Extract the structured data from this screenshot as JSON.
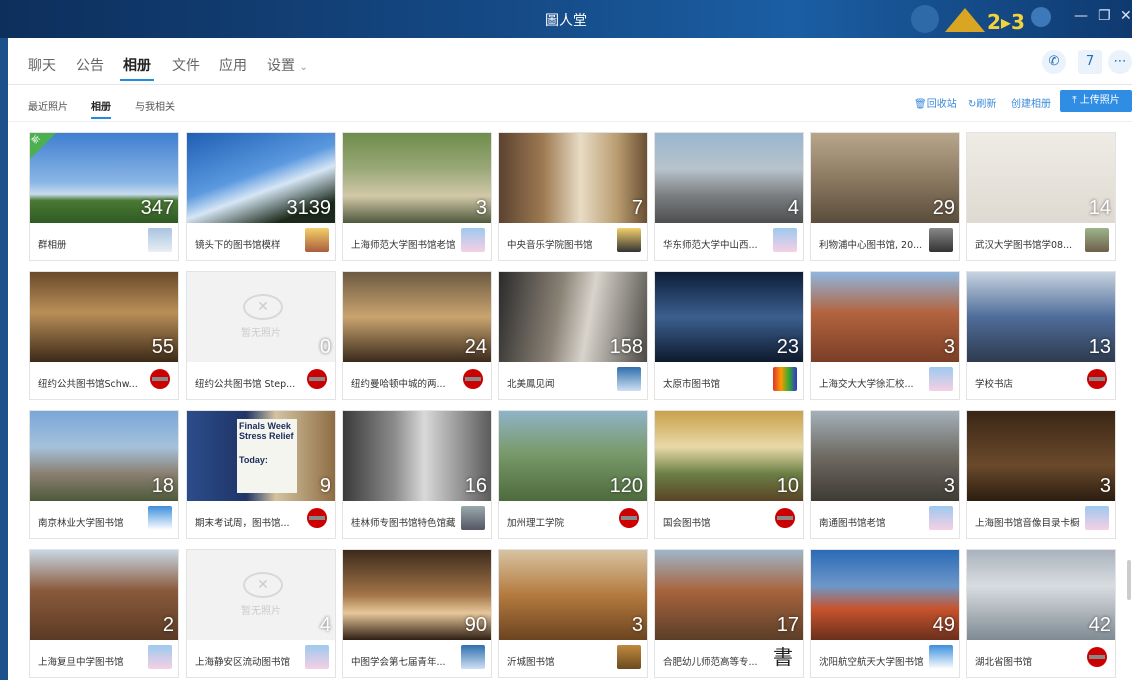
{
  "window": {
    "title": "圖人堂"
  },
  "tabs": [
    "聊天",
    "公告",
    "相册",
    "文件",
    "应用",
    "设置"
  ],
  "subtabs": [
    "最近照片",
    "相册",
    "与我相关"
  ],
  "actions": {
    "recycle": "回收站",
    "refresh": "刷新",
    "create": "创建相册",
    "upload": "上传照片"
  },
  "empty_label": "暂无照片",
  "new_tag": "新",
  "albums": [
    {
      "name": "群相册",
      "count": "347"
    },
    {
      "name": "镜头下的图书馆模样",
      "count": "3139"
    },
    {
      "name": "上海师范大学图书馆老馆",
      "count": "3"
    },
    {
      "name": "中央音乐学院图书馆",
      "count": "7"
    },
    {
      "name": "华东师范大学中山西...",
      "count": "4"
    },
    {
      "name": "利物浦中心图书馆, 20...",
      "count": "29"
    },
    {
      "name": "武汉大学图书馆学08...",
      "count": "14"
    },
    {
      "name": "纽约公共图书馆Schw...",
      "count": "55"
    },
    {
      "name": "纽约公共图书馆 Step...",
      "count": "0"
    },
    {
      "name": "纽约曼哈顿中城的两...",
      "count": "24"
    },
    {
      "name": "北美鳳见闻",
      "count": "158"
    },
    {
      "name": "太原市图书馆",
      "count": "23"
    },
    {
      "name": "上海交大大学徐汇校...",
      "count": "3"
    },
    {
      "name": "学校书店",
      "count": "13"
    },
    {
      "name": "南京林业大学图书馆",
      "count": "18"
    },
    {
      "name": "期末考试周，图书馆...",
      "count": "9"
    },
    {
      "name": "桂林师专图书馆特色馆藏",
      "count": "16"
    },
    {
      "name": "加州理工学院",
      "count": "120"
    },
    {
      "name": "国会图书馆",
      "count": "10"
    },
    {
      "name": "南通图书馆老馆",
      "count": "3"
    },
    {
      "name": "上海图书馆音像目录卡橱",
      "count": "3"
    },
    {
      "name": "上海复旦中学图书馆",
      "count": "2"
    },
    {
      "name": "上海静安区流动图书馆",
      "count": "4"
    },
    {
      "name": "中图学会第七届青年...",
      "count": "90"
    },
    {
      "name": "沂城图书馆",
      "count": "3"
    },
    {
      "name": "合肥幼儿师范高等专...",
      "count": "17"
    },
    {
      "name": "沈阳航空航天大学图书馆",
      "count": "49"
    },
    {
      "name": "湖北省图书馆",
      "count": "42"
    }
  ],
  "thumb_text": {
    "finals_title": "Finals Week Stress Relief",
    "finals_sub": "Today:"
  },
  "avatar_text": {
    "book_char": "書"
  }
}
